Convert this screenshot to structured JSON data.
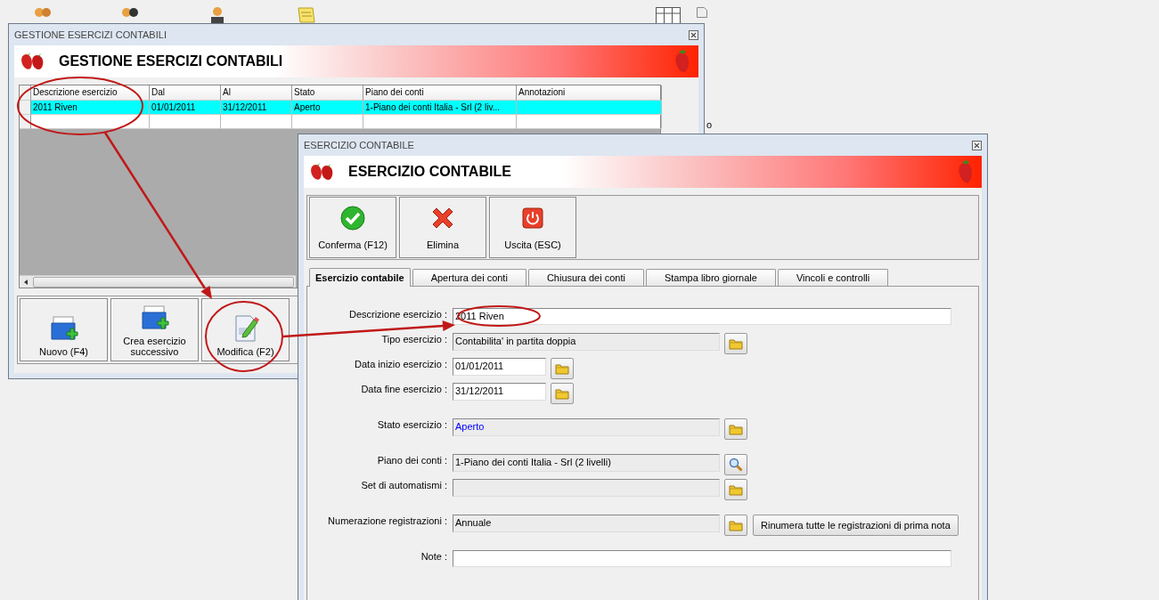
{
  "desktop": {
    "fragments": [
      "o"
    ]
  },
  "list_window": {
    "title": "GESTIONE ESERCIZI CONTABILI",
    "banner": "GESTIONE ESERCIZI CONTABILI",
    "table": {
      "columns": [
        "Descrizione esercizio",
        "Dal",
        "Al",
        "Stato",
        "Piano dei conti",
        "Annotazioni"
      ],
      "rows": [
        {
          "cells": [
            "2011 Riven",
            "01/01/2011",
            "31/12/2011",
            "Aperto",
            "1-Piano dei conti Italia - Srl (2 liv..."
          ],
          "selected": true
        }
      ]
    },
    "buttons": [
      {
        "label": "Nuovo (F4)",
        "kind": "new"
      },
      {
        "label": "Crea esercizio successivo",
        "kind": "new"
      },
      {
        "label": "Modifica (F2)",
        "kind": "edit"
      }
    ]
  },
  "edit_window": {
    "title": "ESERCIZIO CONTABILE",
    "banner": "ESERCIZIO CONTABILE",
    "toolbar": [
      {
        "label": "Conferma (F12)",
        "kind": "confirm"
      },
      {
        "label": "Elimina",
        "kind": "delete"
      },
      {
        "label": "Uscita (ESC)",
        "kind": "exit"
      }
    ],
    "tabs": [
      {
        "label": "Esercizio contabile",
        "selected": true
      },
      {
        "label": "Apertura dei conti",
        "selected": false
      },
      {
        "label": "Chiusura dei conti",
        "selected": false
      },
      {
        "label": "Stampa libro giornale",
        "selected": false
      },
      {
        "label": "Vincoli e controlli",
        "selected": false
      }
    ],
    "form_groups": [
      [
        {
          "label": "Descrizione esercizio :",
          "value": "2011 Riven",
          "kind": "text"
        },
        {
          "label": "Tipo esercizio :",
          "value": "Contabilita' in partita doppia",
          "kind": "lookup"
        },
        {
          "label": "Data inizio esercizio :",
          "value": "01/01/2011",
          "kind": "date"
        },
        {
          "label": "Data fine esercizio :",
          "value": "31/12/2011",
          "kind": "date"
        }
      ],
      [
        {
          "label": "Stato esercizio :",
          "value": "Aperto",
          "kind": "lookup",
          "color": "#0000ff"
        }
      ],
      [
        {
          "label": "Piano dei conti :",
          "value": "1-Piano dei conti Italia - Srl (2 livelli)",
          "kind": "search"
        },
        {
          "label": "Set di automatismi :",
          "kind": "lookup"
        }
      ],
      [
        {
          "label": "Numerazione registrazioni :",
          "value": "Annuale",
          "kind": "lookup",
          "action": "Rinumera tutte le registrazioni di prima nota"
        }
      ],
      [
        {
          "label": "Note :",
          "kind": "text"
        }
      ]
    ]
  }
}
